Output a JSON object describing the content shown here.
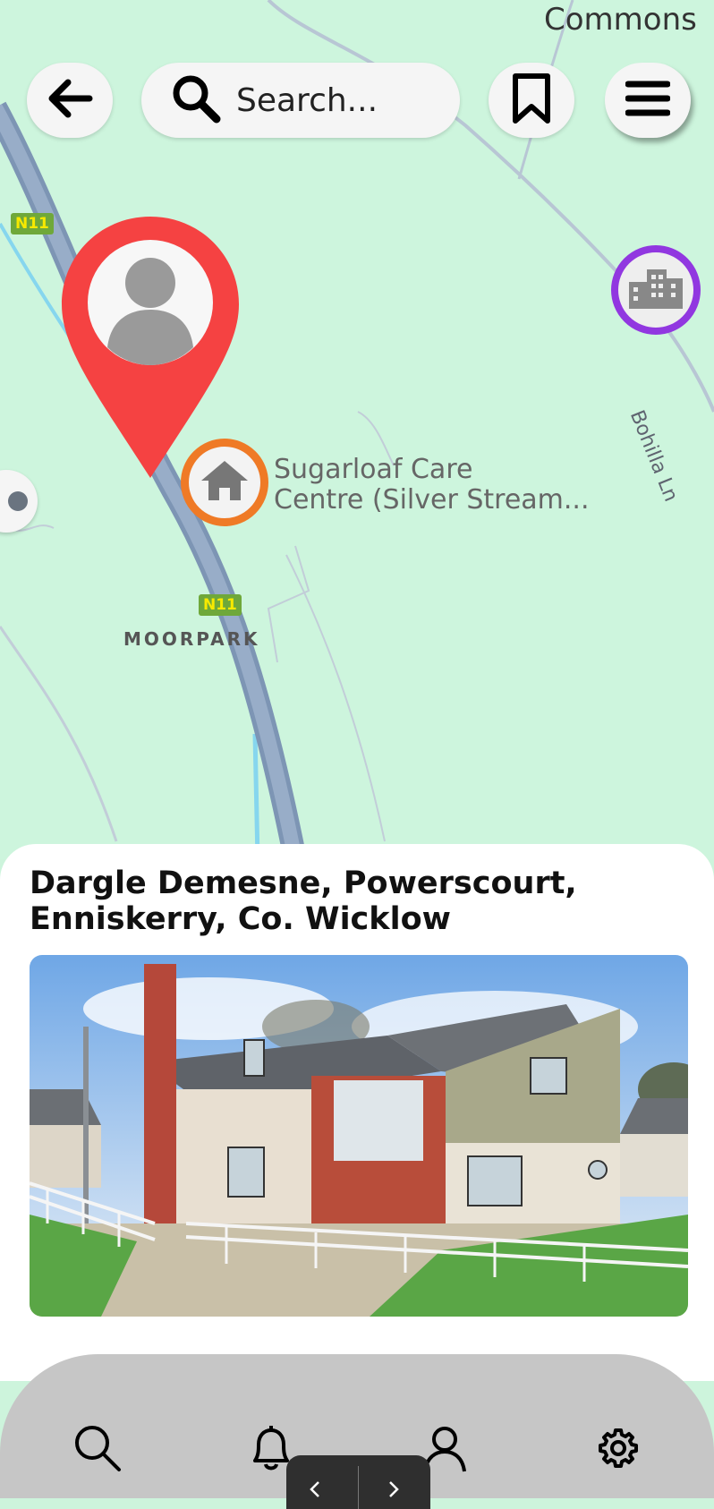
{
  "map": {
    "place_top_right": "Commons",
    "care_centre_line1": "Sugarloaf Care",
    "care_centre_line2": "Centre (Silver Stream...",
    "area_label": "MOORPARK",
    "road_label": "Bohilla Ln",
    "route_shield": "N11",
    "colors": {
      "land": "#cdf5dd",
      "motorway": "#8ba2bf",
      "pin": "#f54141",
      "care_ring": "#ef7a26",
      "building_ring": "#9137e0"
    }
  },
  "toolbar": {
    "back_icon": "arrow-left-icon",
    "search_placeholder": "Search...",
    "bookmark_icon": "bookmark-icon",
    "menu_icon": "hamburger-menu-icon"
  },
  "listing": {
    "address_line1": "Dargle Demesne, Powerscourt,",
    "address_line2": "Enniskerry, Co. Wicklow",
    "photo_description_icon": "house-photo"
  },
  "bottom_nav": {
    "items": [
      {
        "icon": "search-icon"
      },
      {
        "icon": "bell-icon"
      },
      {
        "icon": "user-icon"
      },
      {
        "icon": "gear-icon"
      }
    ]
  }
}
